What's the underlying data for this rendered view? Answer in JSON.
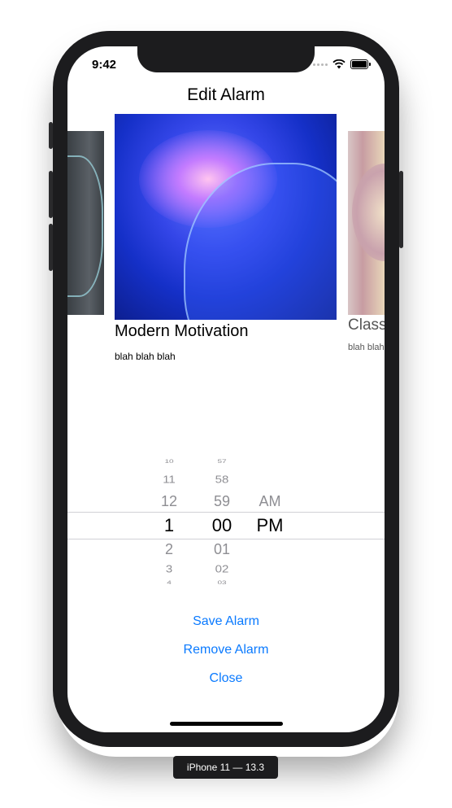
{
  "status_bar": {
    "time": "9:42"
  },
  "nav": {
    "title": "Edit Alarm"
  },
  "carousel": {
    "cards": [
      {
        "title": "Modern Motivation",
        "subtitle": "blah blah blah"
      },
      {
        "title": "Class",
        "subtitle": "blah blah"
      }
    ]
  },
  "picker": {
    "hours": [
      "10",
      "11",
      "12",
      "1",
      "2",
      "3",
      "4"
    ],
    "minutes": [
      "57",
      "58",
      "59",
      "00",
      "01",
      "02",
      "03"
    ],
    "periods": [
      "AM",
      "PM"
    ],
    "selected": {
      "hour": "1",
      "minute": "00",
      "period": "PM"
    }
  },
  "actions": {
    "save": "Save Alarm",
    "remove": "Remove Alarm",
    "close": "Close"
  },
  "device": {
    "label": "iPhone 11 — 13.3"
  },
  "colors": {
    "accent": "#0a7aff",
    "device_frame": "#1c1c1e"
  }
}
